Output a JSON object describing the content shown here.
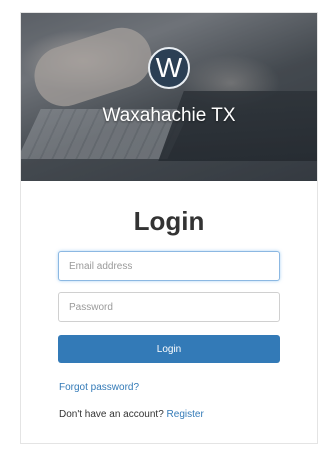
{
  "header": {
    "logo_letter": "W",
    "org_name": "Waxahachie TX"
  },
  "login": {
    "title": "Login",
    "email_placeholder": "Email address",
    "password_placeholder": "Password",
    "submit_label": "Login",
    "forgot_password_label": "Forgot password?",
    "no_account_text": "Don't have an account?",
    "register_label": "Register"
  },
  "colors": {
    "primary": "#337ab7",
    "logo_bg": "#2b3f54"
  }
}
